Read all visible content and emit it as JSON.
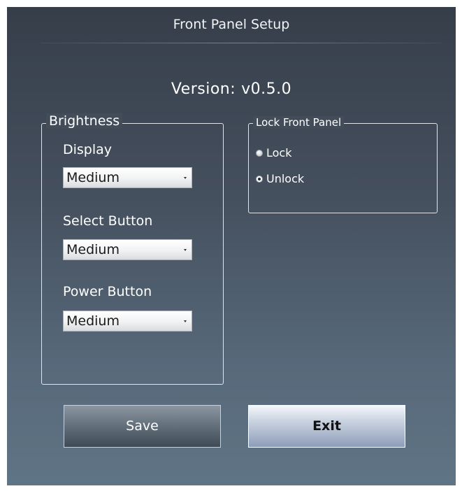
{
  "window": {
    "title": "Front Panel Setup"
  },
  "version": {
    "label": "Version:",
    "value": "v0.5.0"
  },
  "brightness": {
    "legend": "Brightness",
    "fields": [
      {
        "label": "Display",
        "value": "Medium"
      },
      {
        "label": "Select Button",
        "value": "Medium"
      },
      {
        "label": "Power Button",
        "value": "Medium"
      }
    ]
  },
  "lock_panel": {
    "legend": "Lock Front Panel",
    "options": [
      {
        "label": "Lock",
        "selected": false
      },
      {
        "label": "Unlock",
        "selected": true
      }
    ]
  },
  "buttons": {
    "save": "Save",
    "exit": "Exit"
  }
}
